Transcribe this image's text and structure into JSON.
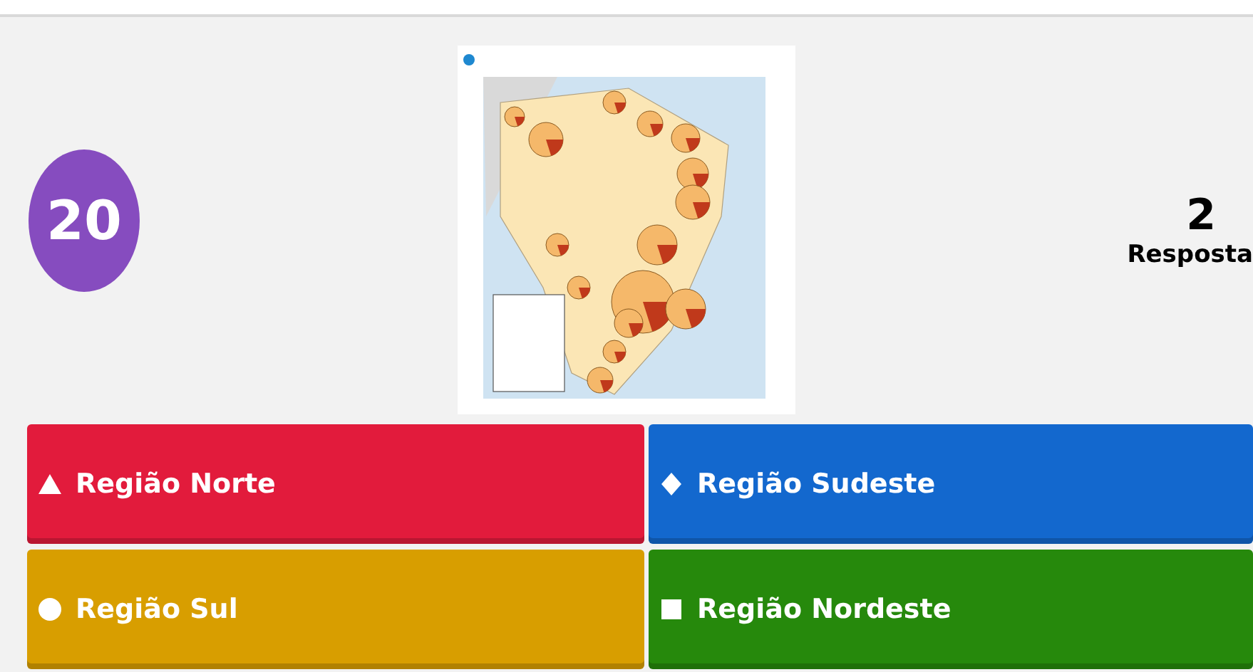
{
  "timer": "20",
  "answers_count": {
    "number": "2",
    "label": "Resposta"
  },
  "answers": [
    {
      "kind": "triangle",
      "label": "Região Norte",
      "color": "#e21b3c"
    },
    {
      "kind": "diamond",
      "label": "Região Sudeste",
      "color": "#1368ce"
    },
    {
      "kind": "circle",
      "label": "Região Sul",
      "color": "#d89e00"
    },
    {
      "kind": "square",
      "label": "Região Nordeste",
      "color": "#26890c"
    }
  ]
}
